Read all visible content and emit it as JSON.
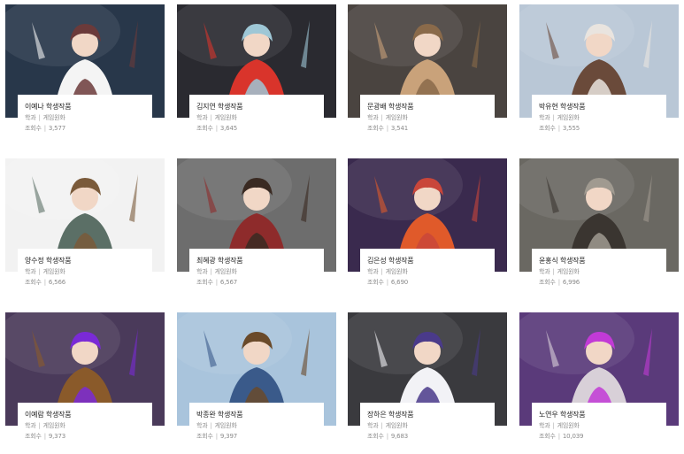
{
  "gallery": {
    "items": [
      {
        "title": "이예나 학생작품",
        "dept_label": "학과",
        "dept": "게임원화",
        "views_label": "조회수",
        "views": "3,577",
        "bg": "#28374a",
        "accent": "#f4f4f4",
        "accent2": "#6b3a3a"
      },
      {
        "title": "김지연 학생작품",
        "dept_label": "학과",
        "dept": "게임원화",
        "views_label": "조회수",
        "views": "3,645",
        "bg": "#2a2a30",
        "accent": "#d9342b",
        "accent2": "#9ec7d6"
      },
      {
        "title": "문광배 학생작품",
        "dept_label": "학과",
        "dept": "게임원화",
        "views_label": "조회수",
        "views": "3,541",
        "bg": "#4a4440",
        "accent": "#c9a27a",
        "accent2": "#8a6a4a"
      },
      {
        "title": "박유현 학생작품",
        "dept_label": "학과",
        "dept": "게임원화",
        "views_label": "조회수",
        "views": "3,555",
        "bg": "#b9c7d6",
        "accent": "#6a4a3a",
        "accent2": "#e9e4df"
      },
      {
        "title": "양수정 학생작품",
        "dept_label": "학과",
        "dept": "게임원화",
        "views_label": "조회수",
        "views": "6,566",
        "bg": "#f2f2f2",
        "accent": "#5b6f66",
        "accent2": "#7a5a3a"
      },
      {
        "title": "최혜광 학생작품",
        "dept_label": "학과",
        "dept": "게임원화",
        "views_label": "조회수",
        "views": "6,567",
        "bg": "#6d6d6d",
        "accent": "#8e2b2b",
        "accent2": "#3a2a22"
      },
      {
        "title": "김은성 학생작품",
        "dept_label": "학과",
        "dept": "게임원화",
        "views_label": "조회수",
        "views": "6,690",
        "bg": "#3a2a4e",
        "accent": "#e05a2a",
        "accent2": "#c9463a"
      },
      {
        "title": "윤홍식 학생작품",
        "dept_label": "학과",
        "dept": "게임원화",
        "views_label": "조회수",
        "views": "6,996",
        "bg": "#6a6862",
        "accent": "#3a3530",
        "accent2": "#a09a90"
      },
      {
        "title": "이예람 학생작품",
        "dept_label": "학과",
        "dept": "게임원화",
        "views_label": "조회수",
        "views": "9,373",
        "bg": "#4a3a5a",
        "accent": "#8a5a2a",
        "accent2": "#7a2ad6"
      },
      {
        "title": "박종완 학생작품",
        "dept_label": "학과",
        "dept": "게임원화",
        "views_label": "조회수",
        "views": "9,397",
        "bg": "#a9c4dc",
        "accent": "#3a5a8a",
        "accent2": "#6a4a2a"
      },
      {
        "title": "장하은 학생작품",
        "dept_label": "학과",
        "dept": "게임원화",
        "views_label": "조회수",
        "views": "9,683",
        "bg": "#3a3a3e",
        "accent": "#f2f2f6",
        "accent2": "#4a3a8a"
      },
      {
        "title": "노연우 학생작품",
        "dept_label": "학과",
        "dept": "게임원화",
        "views_label": "조회수",
        "views": "10,039",
        "bg": "#5a3a7a",
        "accent": "#d8d0d8",
        "accent2": "#c23ad6"
      }
    ]
  }
}
